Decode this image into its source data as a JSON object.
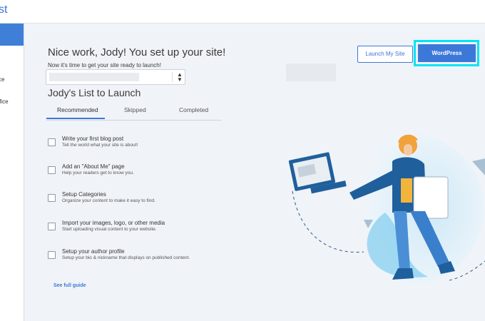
{
  "header": {
    "brand_fragment": "st"
  },
  "sidebar": {
    "items": [
      {
        "label": "ce"
      },
      {
        "label": "ffice"
      }
    ]
  },
  "main": {
    "heading": "Nice work, Jody! You set up your site!",
    "subheading": "Now it's time to get your site ready to launch!",
    "site_selector": {
      "arrows_icon": "up-down-arrows-icon"
    },
    "buttons": {
      "launch_label": "Launch My Site",
      "wordpress_label": "WordPress"
    },
    "list_title": "Jody's List to Launch",
    "tabs": [
      {
        "label": "Recommended"
      },
      {
        "label": "Skipped"
      },
      {
        "label": "Completed"
      }
    ],
    "tasks": [
      {
        "title": "Write your first blog post",
        "desc": "Tell the world what your site is about!"
      },
      {
        "title": "Add an \"About Me\" page",
        "desc": "Help your readers get to know you."
      },
      {
        "title": "Setup Categories",
        "desc": "Organize your content to make it easy to find."
      },
      {
        "title": "Import your images, logo, or other media",
        "desc": "Start uploading visual content to your website."
      },
      {
        "title": "Setup your author profile",
        "desc": "Setup your bio & nickname that displays on published content."
      }
    ],
    "see_full_guide": "See full guide"
  },
  "colors": {
    "accent": "#3c78d8",
    "highlight": "#00e5f6",
    "background": "#f0f3f7"
  }
}
